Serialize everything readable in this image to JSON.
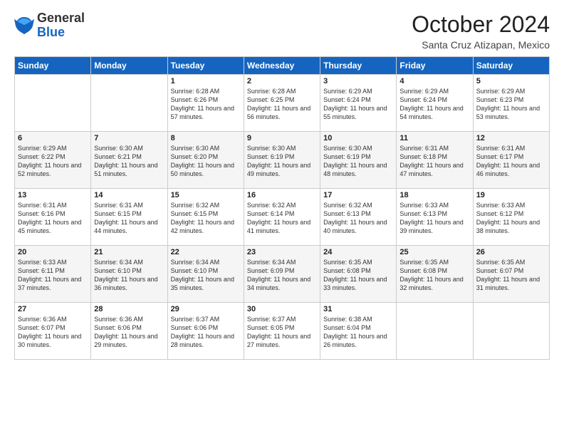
{
  "header": {
    "logo_line1": "General",
    "logo_line2": "Blue",
    "month": "October 2024",
    "location": "Santa Cruz Atizapan, Mexico"
  },
  "days_of_week": [
    "Sunday",
    "Monday",
    "Tuesday",
    "Wednesday",
    "Thursday",
    "Friday",
    "Saturday"
  ],
  "weeks": [
    [
      {
        "day": "",
        "sunrise": "",
        "sunset": "",
        "daylight": ""
      },
      {
        "day": "",
        "sunrise": "",
        "sunset": "",
        "daylight": ""
      },
      {
        "day": "1",
        "sunrise": "Sunrise: 6:28 AM",
        "sunset": "Sunset: 6:26 PM",
        "daylight": "Daylight: 11 hours and 57 minutes."
      },
      {
        "day": "2",
        "sunrise": "Sunrise: 6:28 AM",
        "sunset": "Sunset: 6:25 PM",
        "daylight": "Daylight: 11 hours and 56 minutes."
      },
      {
        "day": "3",
        "sunrise": "Sunrise: 6:29 AM",
        "sunset": "Sunset: 6:24 PM",
        "daylight": "Daylight: 11 hours and 55 minutes."
      },
      {
        "day": "4",
        "sunrise": "Sunrise: 6:29 AM",
        "sunset": "Sunset: 6:24 PM",
        "daylight": "Daylight: 11 hours and 54 minutes."
      },
      {
        "day": "5",
        "sunrise": "Sunrise: 6:29 AM",
        "sunset": "Sunset: 6:23 PM",
        "daylight": "Daylight: 11 hours and 53 minutes."
      }
    ],
    [
      {
        "day": "6",
        "sunrise": "Sunrise: 6:29 AM",
        "sunset": "Sunset: 6:22 PM",
        "daylight": "Daylight: 11 hours and 52 minutes."
      },
      {
        "day": "7",
        "sunrise": "Sunrise: 6:30 AM",
        "sunset": "Sunset: 6:21 PM",
        "daylight": "Daylight: 11 hours and 51 minutes."
      },
      {
        "day": "8",
        "sunrise": "Sunrise: 6:30 AM",
        "sunset": "Sunset: 6:20 PM",
        "daylight": "Daylight: 11 hours and 50 minutes."
      },
      {
        "day": "9",
        "sunrise": "Sunrise: 6:30 AM",
        "sunset": "Sunset: 6:19 PM",
        "daylight": "Daylight: 11 hours and 49 minutes."
      },
      {
        "day": "10",
        "sunrise": "Sunrise: 6:30 AM",
        "sunset": "Sunset: 6:19 PM",
        "daylight": "Daylight: 11 hours and 48 minutes."
      },
      {
        "day": "11",
        "sunrise": "Sunrise: 6:31 AM",
        "sunset": "Sunset: 6:18 PM",
        "daylight": "Daylight: 11 hours and 47 minutes."
      },
      {
        "day": "12",
        "sunrise": "Sunrise: 6:31 AM",
        "sunset": "Sunset: 6:17 PM",
        "daylight": "Daylight: 11 hours and 46 minutes."
      }
    ],
    [
      {
        "day": "13",
        "sunrise": "Sunrise: 6:31 AM",
        "sunset": "Sunset: 6:16 PM",
        "daylight": "Daylight: 11 hours and 45 minutes."
      },
      {
        "day": "14",
        "sunrise": "Sunrise: 6:31 AM",
        "sunset": "Sunset: 6:15 PM",
        "daylight": "Daylight: 11 hours and 44 minutes."
      },
      {
        "day": "15",
        "sunrise": "Sunrise: 6:32 AM",
        "sunset": "Sunset: 6:15 PM",
        "daylight": "Daylight: 11 hours and 42 minutes."
      },
      {
        "day": "16",
        "sunrise": "Sunrise: 6:32 AM",
        "sunset": "Sunset: 6:14 PM",
        "daylight": "Daylight: 11 hours and 41 minutes."
      },
      {
        "day": "17",
        "sunrise": "Sunrise: 6:32 AM",
        "sunset": "Sunset: 6:13 PM",
        "daylight": "Daylight: 11 hours and 40 minutes."
      },
      {
        "day": "18",
        "sunrise": "Sunrise: 6:33 AM",
        "sunset": "Sunset: 6:13 PM",
        "daylight": "Daylight: 11 hours and 39 minutes."
      },
      {
        "day": "19",
        "sunrise": "Sunrise: 6:33 AM",
        "sunset": "Sunset: 6:12 PM",
        "daylight": "Daylight: 11 hours and 38 minutes."
      }
    ],
    [
      {
        "day": "20",
        "sunrise": "Sunrise: 6:33 AM",
        "sunset": "Sunset: 6:11 PM",
        "daylight": "Daylight: 11 hours and 37 minutes."
      },
      {
        "day": "21",
        "sunrise": "Sunrise: 6:34 AM",
        "sunset": "Sunset: 6:10 PM",
        "daylight": "Daylight: 11 hours and 36 minutes."
      },
      {
        "day": "22",
        "sunrise": "Sunrise: 6:34 AM",
        "sunset": "Sunset: 6:10 PM",
        "daylight": "Daylight: 11 hours and 35 minutes."
      },
      {
        "day": "23",
        "sunrise": "Sunrise: 6:34 AM",
        "sunset": "Sunset: 6:09 PM",
        "daylight": "Daylight: 11 hours and 34 minutes."
      },
      {
        "day": "24",
        "sunrise": "Sunrise: 6:35 AM",
        "sunset": "Sunset: 6:08 PM",
        "daylight": "Daylight: 11 hours and 33 minutes."
      },
      {
        "day": "25",
        "sunrise": "Sunrise: 6:35 AM",
        "sunset": "Sunset: 6:08 PM",
        "daylight": "Daylight: 11 hours and 32 minutes."
      },
      {
        "day": "26",
        "sunrise": "Sunrise: 6:35 AM",
        "sunset": "Sunset: 6:07 PM",
        "daylight": "Daylight: 11 hours and 31 minutes."
      }
    ],
    [
      {
        "day": "27",
        "sunrise": "Sunrise: 6:36 AM",
        "sunset": "Sunset: 6:07 PM",
        "daylight": "Daylight: 11 hours and 30 minutes."
      },
      {
        "day": "28",
        "sunrise": "Sunrise: 6:36 AM",
        "sunset": "Sunset: 6:06 PM",
        "daylight": "Daylight: 11 hours and 29 minutes."
      },
      {
        "day": "29",
        "sunrise": "Sunrise: 6:37 AM",
        "sunset": "Sunset: 6:06 PM",
        "daylight": "Daylight: 11 hours and 28 minutes."
      },
      {
        "day": "30",
        "sunrise": "Sunrise: 6:37 AM",
        "sunset": "Sunset: 6:05 PM",
        "daylight": "Daylight: 11 hours and 27 minutes."
      },
      {
        "day": "31",
        "sunrise": "Sunrise: 6:38 AM",
        "sunset": "Sunset: 6:04 PM",
        "daylight": "Daylight: 11 hours and 26 minutes."
      },
      {
        "day": "",
        "sunrise": "",
        "sunset": "",
        "daylight": ""
      },
      {
        "day": "",
        "sunrise": "",
        "sunset": "",
        "daylight": ""
      }
    ]
  ]
}
